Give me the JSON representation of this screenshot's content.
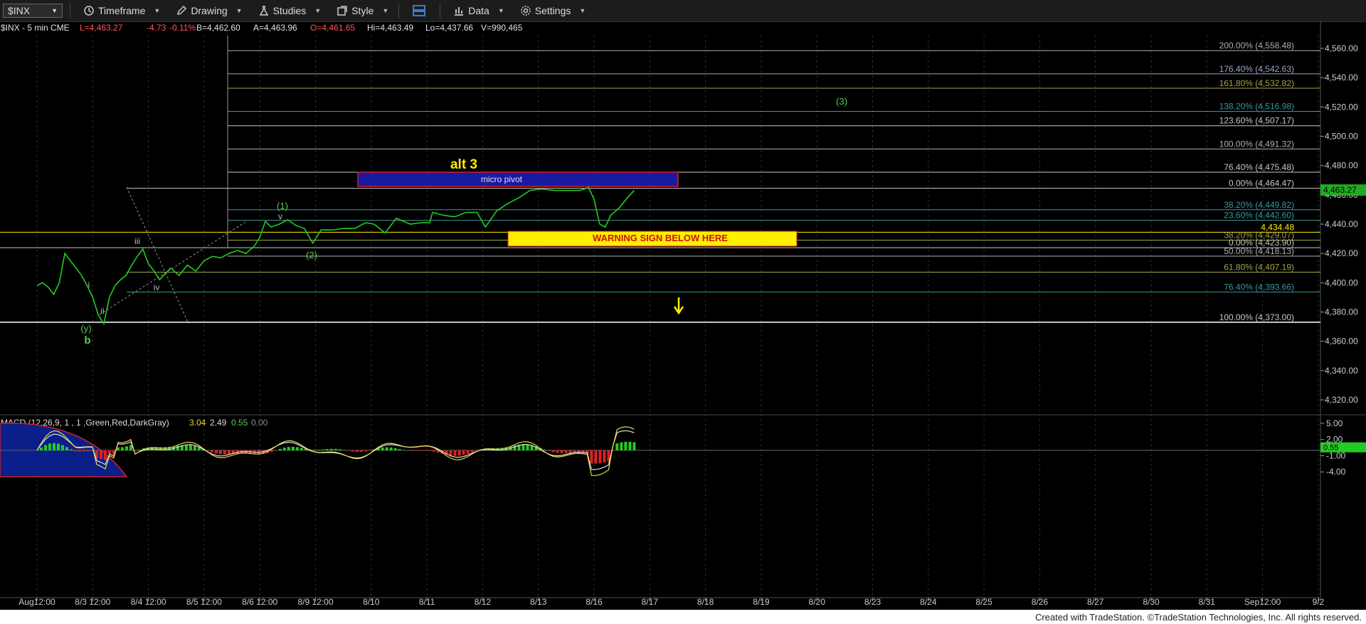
{
  "toolbar": {
    "symbol": "$INX",
    "timeframe": "Timeframe",
    "drawing": "Drawing",
    "studies": "Studies",
    "style": "Style",
    "data": "Data",
    "settings": "Settings"
  },
  "header": {
    "symbol_label": "$INX - 5 min  CME",
    "last": "L=4,463.27",
    "change": "-4.73",
    "pct": "-0.11%",
    "bid": "B=4,462.60",
    "ask": "A=4,463.96",
    "open": "O=4,461.65",
    "hi": "Hi=4,463.49",
    "lo": "Lo=4,437.66",
    "vol": "V=990,465"
  },
  "colors": {
    "price": "#22cc22",
    "macd_pos": "#22cc22",
    "macd_neg": "#dd2222",
    "warning": "#ffee00",
    "pivot": "#1a1aa0",
    "background": "#000000"
  },
  "chart_data": {
    "type": "line",
    "ylim": [
      4300,
      4572
    ],
    "y_ticks": [
      "4,560.00",
      "4,540.00",
      "4,520.00",
      "4,500.00",
      "4,480.00",
      "4,460.00",
      "4,440.00",
      "4,420.00",
      "4,400.00",
      "4,380.00",
      "4,360.00",
      "4,340.00",
      "4,320.00"
    ],
    "y_tick_values": [
      4560,
      4540,
      4520,
      4500,
      4480,
      4460,
      4440,
      4420,
      4400,
      4380,
      4360,
      4340,
      4320
    ],
    "x_labels": [
      "Aug12:00",
      "8/3 12:00",
      "8/4 12:00",
      "8/5 12:00",
      "8/6 12:00",
      "8/9 12:00",
      "8/10",
      "8/11",
      "8/12",
      "8/13",
      "8/16",
      "8/17",
      "8/18",
      "8/19",
      "8/20",
      "8/23",
      "8/24",
      "8/25",
      "8/26",
      "8/27",
      "8/30",
      "8/31",
      "Sep12:00",
      "9/2"
    ],
    "x_label_index": [
      0,
      1,
      2,
      3,
      4,
      5,
      6,
      7,
      8,
      9,
      10,
      11,
      12,
      13,
      14,
      15,
      16,
      17,
      18,
      19,
      20,
      21,
      22,
      23
    ],
    "last_price": "4,463.27",
    "fib_levels": [
      {
        "label": "200.00% (4,558.48)",
        "value": 4558.48,
        "color": "#b0b0b0"
      },
      {
        "label": "176.40% (4,542.63)",
        "value": 4542.63,
        "color": "#9aa4c8"
      },
      {
        "label": "161.80% (4,532.82)",
        "value": 4532.82,
        "color": "#a8a24a"
      },
      {
        "label": "138.20% (4,516.98)",
        "value": 4516.98,
        "color": "#3a9aa0"
      },
      {
        "label": "123.60% (4,507.17)",
        "value": 4507.17,
        "color": "#c8c8c8"
      },
      {
        "label": "100.00% (4,491.32)",
        "value": 4491.32,
        "color": "#b0b0b0"
      },
      {
        "label": "76.40% (4,475.48)",
        "value": 4475.48,
        "color": "#c8c8c8"
      },
      {
        "label": "0.00% (4,464.47)",
        "value": 4464.47,
        "color": "#c8c8c8"
      },
      {
        "label": "38.20% (4,449.82)",
        "value": 4449.82,
        "color": "#3a9aa0"
      },
      {
        "label": "23.60% (4,442.60)",
        "value": 4442.6,
        "color": "#3a9aa0"
      },
      {
        "label": "4,434.48",
        "value": 4434.48,
        "color": "#ffee00"
      },
      {
        "label": "38.20% (4,429.07)",
        "value": 4429.07,
        "color": "#a8a24a"
      },
      {
        "label": "0.00% (4,423.90)",
        "value": 4423.9,
        "color": "#c8c8c8"
      },
      {
        "label": "50.00% (4,418.13)",
        "value": 4418.13,
        "color": "#b0b0b0"
      },
      {
        "label": "61.80% (4,407.19)",
        "value": 4407.19,
        "color": "#a8a24a"
      },
      {
        "label": "76.40% (4,393.66)",
        "value": 4393.66,
        "color": "#3a9aa0"
      },
      {
        "label": "100.00% (4,373.00)",
        "value": 4373.0,
        "color": "#c8c8c8"
      }
    ],
    "annotations": {
      "alt3": "alt 3",
      "micro_pivot": "micro pivot",
      "warning": "WARNING SIGN BELOW HERE",
      "wave_3": "(3)",
      "wave_1": "(1)",
      "wave_2": "(2)",
      "wave_v": "v",
      "wave_iii": "iii",
      "wave_iv": "iv",
      "wave_i": "i",
      "wave_ii": "ii",
      "wave_y": "(y)",
      "wave_b": "b"
    },
    "price_series": [
      [
        0,
        4398
      ],
      [
        0.1,
        4400
      ],
      [
        0.2,
        4397
      ],
      [
        0.3,
        4392
      ],
      [
        0.4,
        4400
      ],
      [
        0.5,
        4420
      ],
      [
        0.6,
        4415
      ],
      [
        0.7,
        4410
      ],
      [
        0.8,
        4405
      ],
      [
        0.9,
        4398
      ],
      [
        1.0,
        4390
      ],
      [
        1.1,
        4378
      ],
      [
        1.2,
        4372
      ],
      [
        1.3,
        4390
      ],
      [
        1.4,
        4398
      ],
      [
        1.5,
        4402
      ],
      [
        1.6,
        4405
      ],
      [
        1.7,
        4412
      ],
      [
        1.8,
        4418
      ],
      [
        1.9,
        4423
      ],
      [
        2.0,
        4413
      ],
      [
        2.1,
        4408
      ],
      [
        2.2,
        4402
      ],
      [
        2.3,
        4406
      ],
      [
        2.4,
        4410
      ],
      [
        2.55,
        4405
      ],
      [
        2.7,
        4412
      ],
      [
        2.85,
        4408
      ],
      [
        3.0,
        4415
      ],
      [
        3.15,
        4418
      ],
      [
        3.3,
        4417
      ],
      [
        3.45,
        4420
      ],
      [
        3.6,
        4422
      ],
      [
        3.75,
        4420
      ],
      [
        3.9,
        4425
      ],
      [
        4.0,
        4431
      ],
      [
        4.1,
        4442
      ],
      [
        4.2,
        4438
      ],
      [
        4.35,
        4440
      ],
      [
        4.5,
        4443
      ],
      [
        4.65,
        4439
      ],
      [
        4.8,
        4437
      ],
      [
        4.95,
        4427
      ],
      [
        5.1,
        4436
      ],
      [
        5.3,
        4436
      ],
      [
        5.5,
        4437
      ],
      [
        5.7,
        4437
      ],
      [
        5.9,
        4441
      ],
      [
        6.05,
        4440
      ],
      [
        6.25,
        4434
      ],
      [
        6.45,
        4444
      ],
      [
        6.7,
        4440
      ],
      [
        6.9,
        4441
      ],
      [
        7.05,
        4441
      ],
      [
        7.1,
        4448
      ],
      [
        7.3,
        4446
      ],
      [
        7.5,
        4445
      ],
      [
        7.7,
        4448
      ],
      [
        7.9,
        4448
      ],
      [
        8.05,
        4438
      ],
      [
        8.25,
        4449
      ],
      [
        8.45,
        4454
      ],
      [
        8.65,
        4458
      ],
      [
        8.85,
        4463
      ],
      [
        9.05,
        4464
      ],
      [
        9.3,
        4463
      ],
      [
        9.55,
        4463
      ],
      [
        9.75,
        4463
      ],
      [
        9.9,
        4465
      ],
      [
        10.0,
        4457
      ],
      [
        10.1,
        4440
      ],
      [
        10.2,
        4438
      ],
      [
        10.3,
        4446
      ],
      [
        10.45,
        4451
      ],
      [
        10.6,
        4458
      ],
      [
        10.72,
        4463
      ]
    ],
    "macd": {
      "label": "MACD (12,26,9, 1 , 1 ,Green,Red,DarkGray)",
      "macd_value": "3.04",
      "signal_value": "2.49",
      "hist_value": "0.55",
      "zero_value": "0.00",
      "y_ticks": [
        "5.00",
        "2.00",
        "-1.00",
        "-4.00"
      ],
      "y_tick_values": [
        5,
        2,
        -1,
        -4
      ],
      "current": "0.55"
    }
  },
  "footer": {
    "text": "Created with TradeStation. ©TradeStation Technologies, Inc. All rights reserved."
  }
}
